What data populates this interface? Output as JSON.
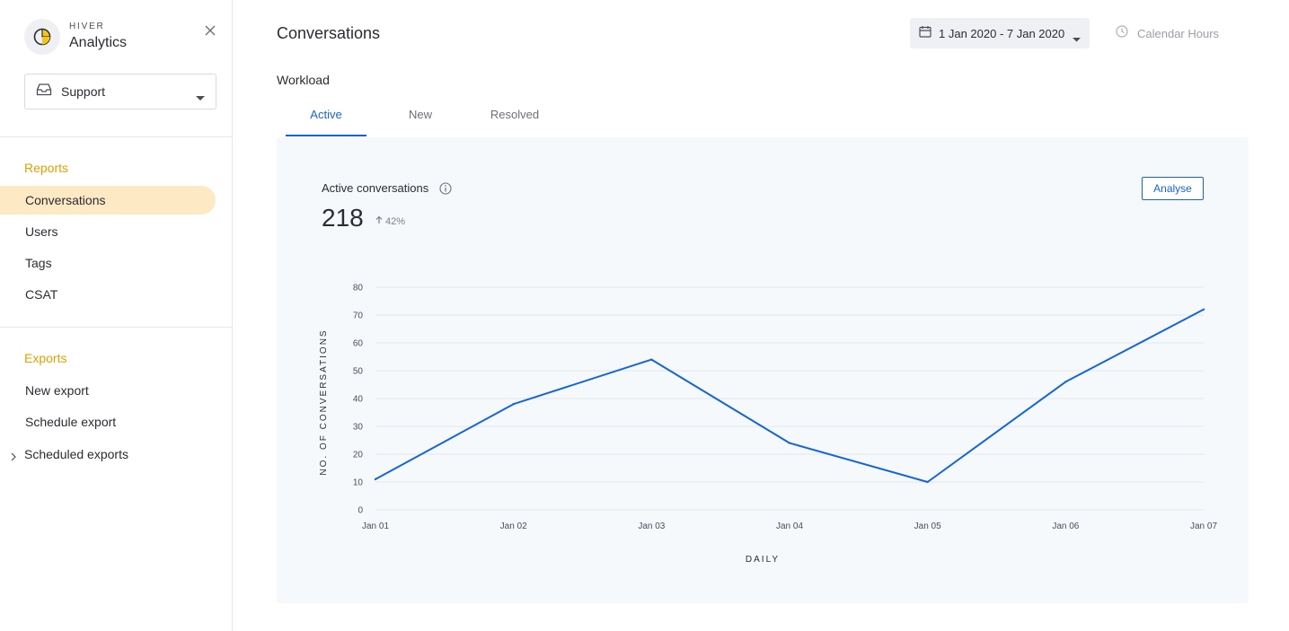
{
  "brand": {
    "top": "HIVER",
    "name": "Analytics"
  },
  "team_select": {
    "value": "Support"
  },
  "sidebar": {
    "reports_title": "Reports",
    "reports": [
      {
        "label": "Conversations",
        "active": true
      },
      {
        "label": "Users"
      },
      {
        "label": "Tags"
      },
      {
        "label": "CSAT"
      }
    ],
    "exports_title": "Exports",
    "exports": [
      {
        "label": "New export"
      },
      {
        "label": "Schedule export"
      },
      {
        "label": "Scheduled exports"
      }
    ]
  },
  "header": {
    "title": "Conversations",
    "date_range": "1 Jan 2020 - 7 Jan 2020",
    "hours_label": "Calendar Hours"
  },
  "section": {
    "label": "Workload"
  },
  "tabs": [
    {
      "label": "Active",
      "active": true
    },
    {
      "label": "New"
    },
    {
      "label": "Resolved"
    }
  ],
  "metric": {
    "label": "Active conversations",
    "value": "218",
    "delta": "42%",
    "analyse_label": "Analyse"
  },
  "colors": {
    "accent": "#1565d8",
    "highlight": "#fde9c4",
    "section_title": "#e0a100",
    "card_bg": "#f6f9fc"
  },
  "chart_data": {
    "type": "line",
    "categories": [
      "Jan 01",
      "Jan 02",
      "Jan 03",
      "Jan 04",
      "Jan 05",
      "Jan 06",
      "Jan 07"
    ],
    "series": [
      {
        "values": [
          11,
          38,
          54,
          24,
          10,
          46,
          72
        ]
      }
    ],
    "xlabel": "DAILY",
    "ylabel": "NO. OF CONVERSATIONS",
    "ylim": [
      0,
      80
    ],
    "yticks": [
      "0",
      "10",
      "20",
      "30",
      "40",
      "50",
      "60",
      "70",
      "80"
    ],
    "grid": true,
    "line_color": "#1565d8"
  }
}
